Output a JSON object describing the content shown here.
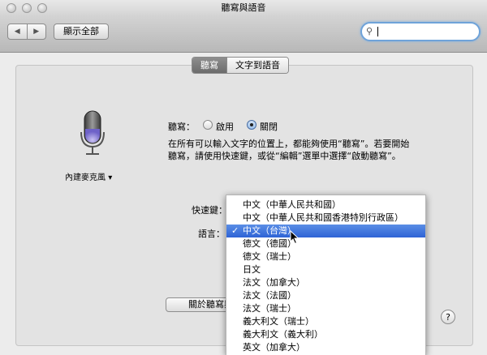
{
  "window": {
    "title": "聽寫與語音"
  },
  "toolbar": {
    "back": "◀",
    "forward": "▶",
    "show_all": "顯示全部",
    "search_value": ""
  },
  "tabs": [
    {
      "label": "聽寫",
      "active": true
    },
    {
      "label": "文字到語音",
      "active": false
    }
  ],
  "mic": {
    "label": "內建麥克風"
  },
  "dictation": {
    "label": "聽寫：",
    "on_label": "啟用",
    "off_label": "關閉",
    "selected": "off",
    "description": "在所有可以輸入文字的位置上，都能夠使用“聽寫”。若要開始聽寫，請使用快速鍵，或從“編輯”選單中選擇“啟動聽寫”。"
  },
  "shortcut": {
    "label": "快速鍵："
  },
  "language": {
    "label": "語言：",
    "check": "✓",
    "options": [
      "中文（中華人民共和國）",
      "中文（中華人民共和國香港特別行政區）",
      "中文（台灣）",
      "德文（德國）",
      "德文（瑞士）",
      "日文",
      "法文（加拿大）",
      "法文（法國）",
      "法文（瑞士）",
      "義大利文（瑞士）",
      "義大利文（義大利）",
      "英文（加拿大）"
    ],
    "selected_index": 2
  },
  "about_button": "關於聽寫與隱私權",
  "help": "?",
  "icons": {
    "mic": "microphone-icon",
    "search": "search-icon",
    "help": "help-icon"
  }
}
